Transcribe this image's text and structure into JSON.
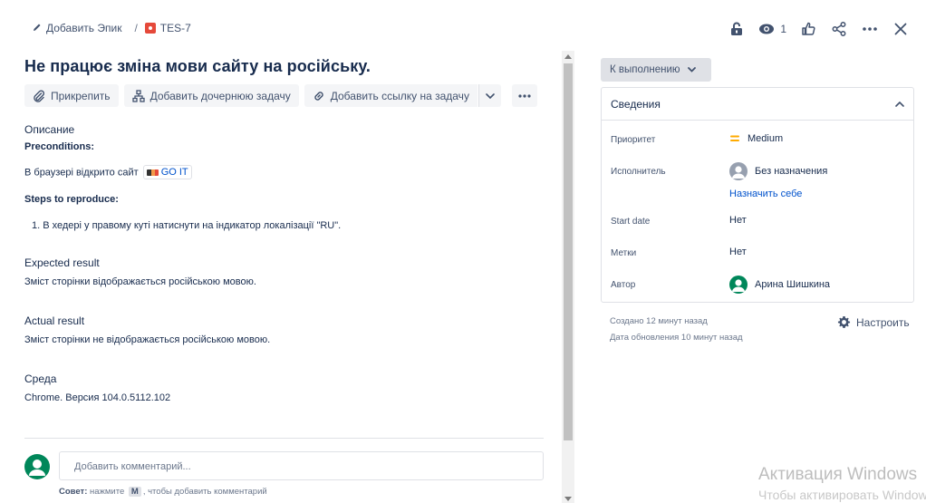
{
  "breadcrumb": {
    "add_epic": "Добавить Эпик",
    "separator": "/",
    "issue_key": "TES-7"
  },
  "top_actions": {
    "watch_count": "1"
  },
  "issue": {
    "title": "Не працює зміна мови сайту на російську."
  },
  "toolbar": {
    "attach": "Прикрепить",
    "add_child": "Добавить дочернюю задачу",
    "add_link": "Добавить ссылку на задачу"
  },
  "description": {
    "label": "Описание",
    "preconditions_label": "Preconditions:",
    "precondition_text": "В браузері відкрито сайт",
    "site_link": "GO IT",
    "steps_label": "Steps to reproduce:",
    "step_1": "1. В хедері у правому куті натиснути на індикатор локалізації \"RU\".",
    "expected_label": "Expected result",
    "expected_text": "Зміст сторінки відображається російською мовою.",
    "actual_label": "Actual result",
    "actual_text": "Зміст сторінки не відображається російською мовою.",
    "env_label": "Среда",
    "env_text": "Chrome. Версия 104.0.5112.102"
  },
  "comment": {
    "placeholder": "Добавить комментарий...",
    "tip_prefix": "Совет:",
    "tip_press": "нажмите",
    "tip_key": "M",
    "tip_suffix": ", чтобы добавить комментарий"
  },
  "status": {
    "label": "К выполнению"
  },
  "details": {
    "header": "Сведения",
    "priority_label": "Приоритет",
    "priority_value": "Medium",
    "assignee_label": "Исполнитель",
    "assignee_value": "Без назначения",
    "assign_to_me": "Назначить себе",
    "start_date_label": "Start date",
    "start_date_value": "Нет",
    "labels_label": "Метки",
    "labels_value": "Нет",
    "reporter_label": "Автор",
    "reporter_value": "Арина Шишкина"
  },
  "meta": {
    "created": "Создано 12 минут назад",
    "updated": "Дата обновления 10 минут назад",
    "configure": "Настроить"
  },
  "watermark": {
    "line1": "Активация Windows",
    "line2": "Чтобы активировать Windows"
  },
  "colors": {
    "accent": "#0052cc",
    "bug": "#e5493a",
    "priority_medium": "#ffab00",
    "avatar_green": "#00875a"
  }
}
